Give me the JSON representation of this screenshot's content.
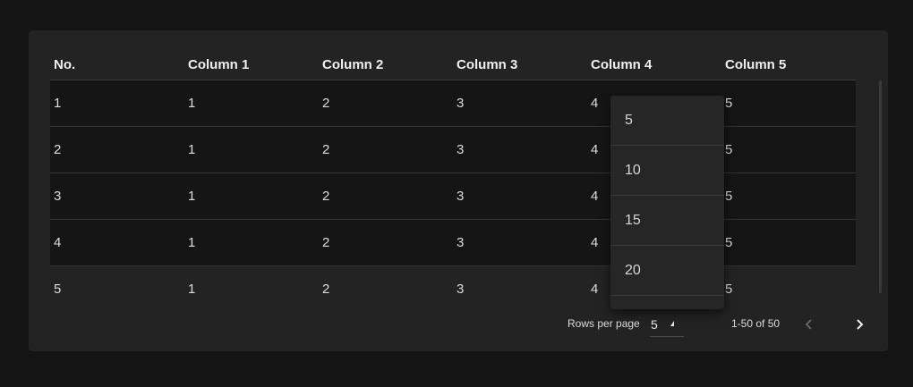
{
  "table": {
    "headers": [
      "No.",
      "Column 1",
      "Column 2",
      "Column 3",
      "Column 4",
      "Column 5"
    ],
    "rows": [
      [
        "1",
        "1",
        "2",
        "3",
        "4",
        "5"
      ],
      [
        "2",
        "1",
        "2",
        "3",
        "4",
        "5"
      ],
      [
        "3",
        "1",
        "2",
        "3",
        "4",
        "5"
      ],
      [
        "4",
        "1",
        "2",
        "3",
        "4",
        "5"
      ],
      [
        "5",
        "1",
        "2",
        "3",
        "4",
        "5"
      ]
    ]
  },
  "pagination": {
    "rows_per_page_label": "Rows per page",
    "rows_per_page_value": "5",
    "range_text": "1-50 of 50",
    "prev_icon": "chevron-left-icon",
    "next_icon": "chevron-right-icon"
  },
  "dropdown": {
    "options": [
      "5",
      "10",
      "15",
      "20"
    ]
  },
  "colors": {
    "background": "#141414",
    "card": "#232323",
    "row_dark": "#151515",
    "dropdown": "#262626"
  }
}
